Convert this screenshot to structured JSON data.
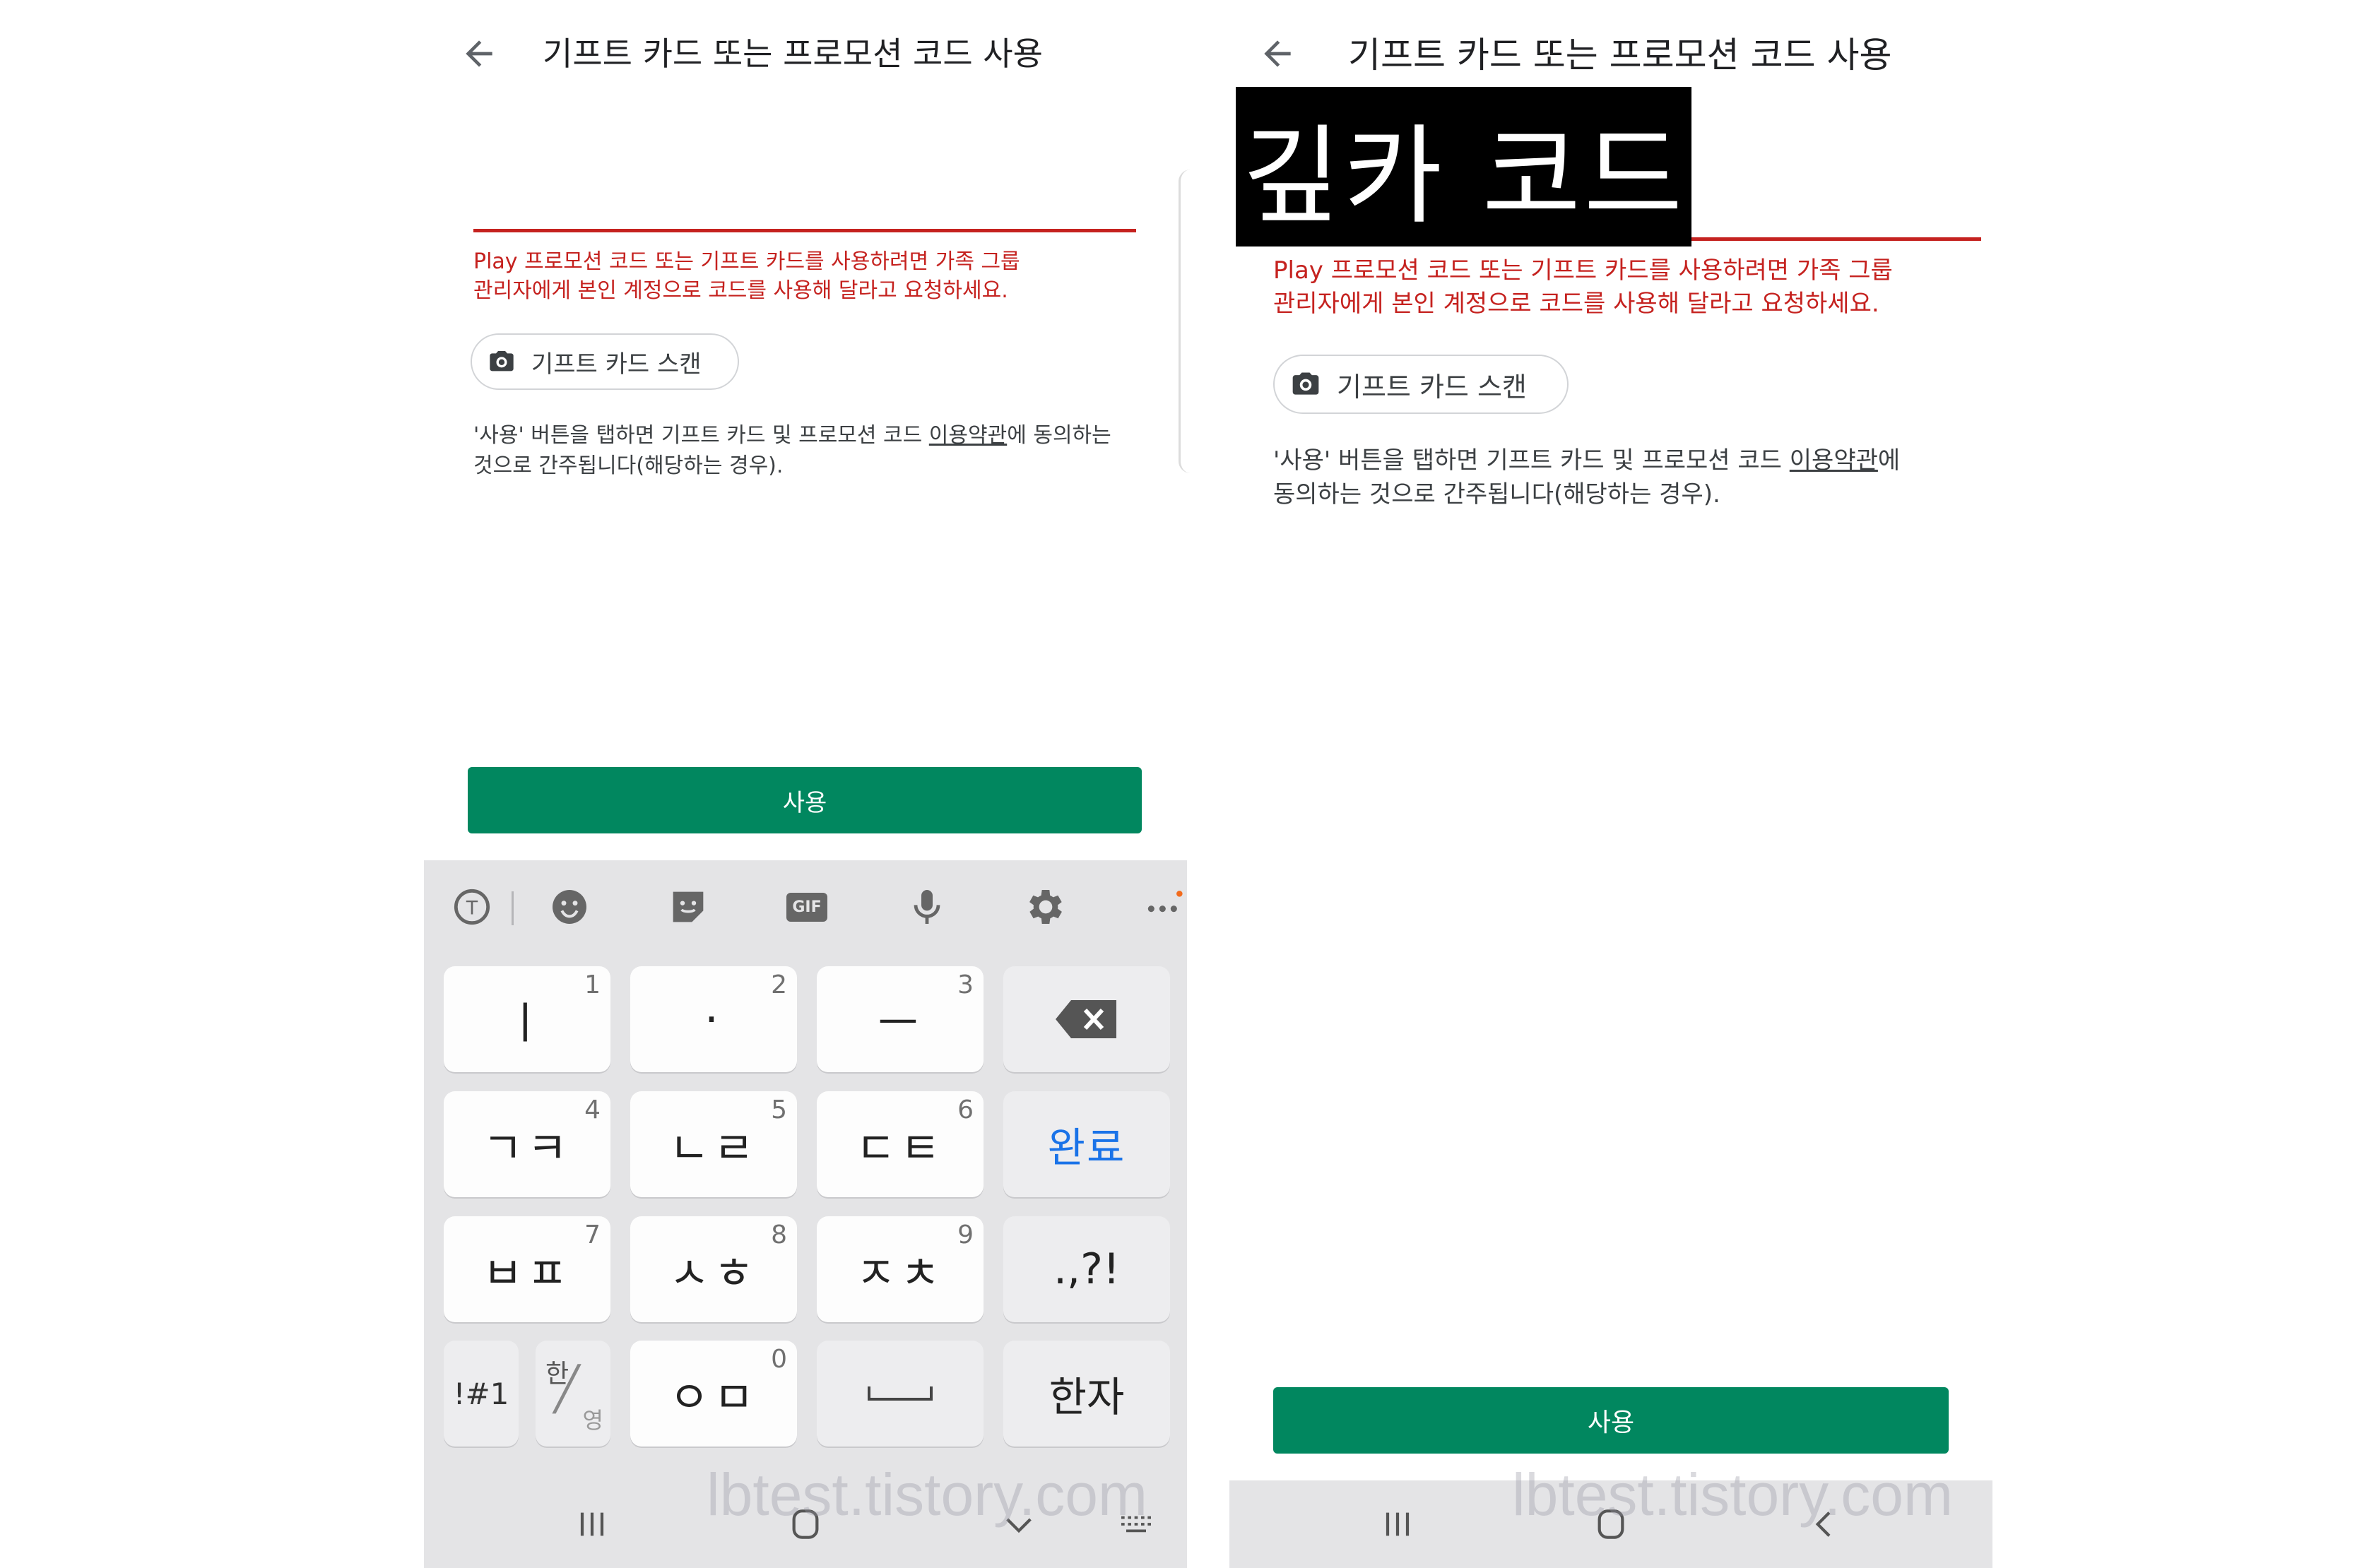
{
  "left": {
    "title": "기프트 카드 또는 프로모션 코드 사용",
    "error_line1": "Play 프로모션 코드 또는 기프트 카드를 사용하려면 가족 그룹",
    "error_line2": "관리자에게 본인 계정으로 코드를 사용해 달라고 요청하세요.",
    "scan_label": "기프트 카드 스캔",
    "terms_line1_a": "'사용' 버튼을 탭하면 기프트 카드 및 프로모션 코드 ",
    "terms_link": "이용약관",
    "terms_line1_b": "에 동의하는",
    "terms_line2": "것으로 간주됩니다(해당하는 경우).",
    "use_button": "사용"
  },
  "right": {
    "title": "기프트 카드 또는 프로모션 코드 사용",
    "redaction_label": "깊카 코드",
    "error_line1": "Play 프로모션 코드 또는 기프트 카드를 사용하려면 가족 그룹",
    "error_line2": "관리자에게 본인 계정으로 코드를 사용해 달라고 요청하세요.",
    "scan_label": "기프트 카드 스캔",
    "terms_line1_a": "'사용' 버튼을 탭하면 기프트 카드 및 프로모션 코드 ",
    "terms_link": "이용약관",
    "terms_line1_b": "에",
    "terms_line2": "동의하는 것으로 간주됩니다(해당하는 경우).",
    "use_button": "사용"
  },
  "keyboard": {
    "toolbar_icons": [
      "translate-icon",
      "emoji-icon",
      "sticker-icon",
      "gif-icon",
      "mic-icon",
      "gear-icon",
      "more-icon"
    ],
    "gif_label": "GIF",
    "keys": {
      "k1": {
        "num": "1",
        "main": "ㅣ"
      },
      "k2": {
        "num": "2",
        "main": "·"
      },
      "k3": {
        "num": "3",
        "main": "ㅡ"
      },
      "k4": {
        "num": "4",
        "main": "ㄱㅋ"
      },
      "k5": {
        "num": "5",
        "main": "ㄴㄹ"
      },
      "k6": {
        "num": "6",
        "main": "ㄷㅌ"
      },
      "k7": {
        "num": "7",
        "main": "ㅂㅍ"
      },
      "k8": {
        "num": "8",
        "main": "ㅅㅎ"
      },
      "k9": {
        "num": "9",
        "main": "ㅈㅊ"
      },
      "k0": {
        "num": "0",
        "main": "ㅇㅁ"
      },
      "done": "완료",
      "punct": ".,?!",
      "symbols": "!#1",
      "han": "한",
      "eng": "영",
      "hanja": "한자"
    }
  },
  "watermark": "lbtest.tistory.com",
  "colors": {
    "accent_green": "#01875f",
    "error_red": "#c5221f",
    "done_blue": "#1a73e8"
  }
}
